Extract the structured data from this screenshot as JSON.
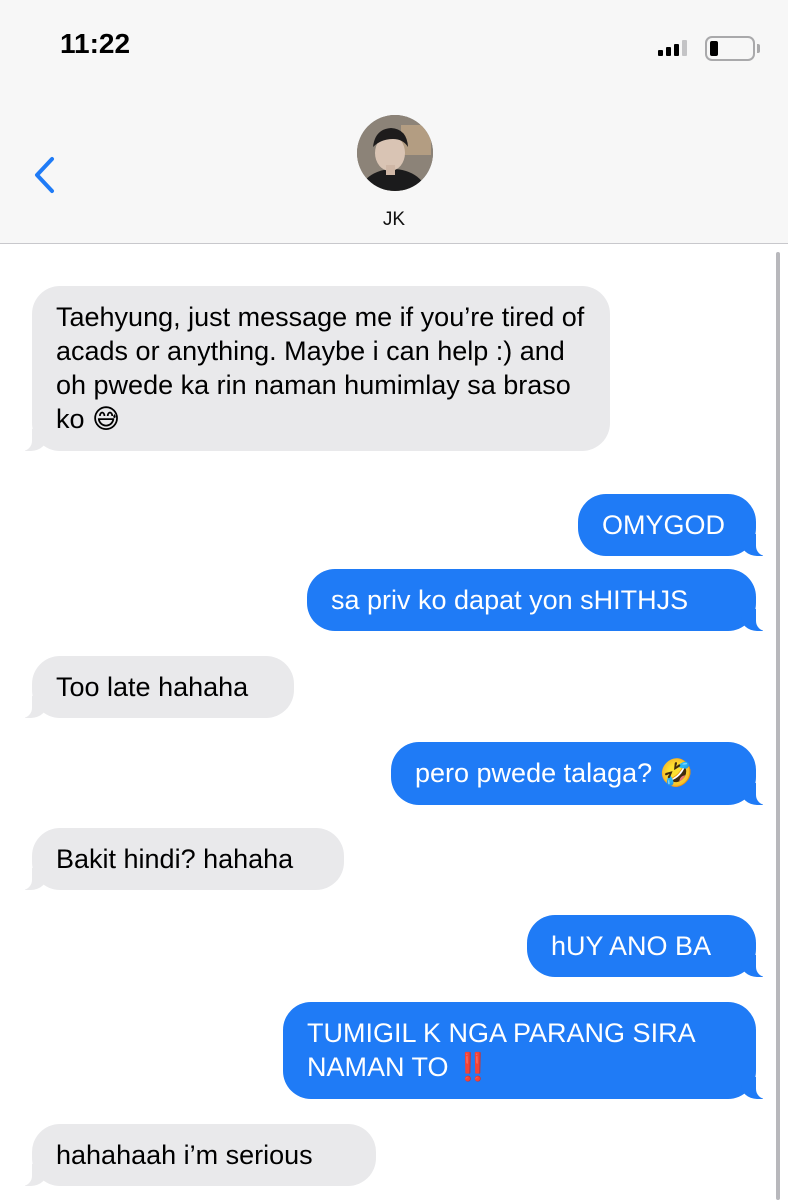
{
  "status_bar": {
    "time": "11:22",
    "signal_bars_lit": 3,
    "signal_bars_total": 4,
    "battery_level_fraction": 0.2
  },
  "header": {
    "contact_name": "JK",
    "back_icon": "chevron-left-icon",
    "accent_color": "#1f7bf6"
  },
  "messages": [
    {
      "direction": "received",
      "text": "Taehyung, just message me if you’re tired of acads or anything. Maybe i can help :) and oh pwede ka rin naman humimlay sa braso ko",
      "emoji": "😅"
    },
    {
      "direction": "sent",
      "text": "OMYGOD"
    },
    {
      "direction": "sent",
      "text": "sa priv ko dapat yon sHITHJS"
    },
    {
      "direction": "received",
      "text": "Too late hahaha"
    },
    {
      "direction": "sent",
      "text": "pero pwede talaga?",
      "emoji": "🤣"
    },
    {
      "direction": "received",
      "text": "Bakit hindi? hahaha"
    },
    {
      "direction": "sent",
      "text": "hUY ANO BA"
    },
    {
      "direction": "sent",
      "text": "TUMIGIL K NGA PARANG SIRA NAMAN TO",
      "emoji": "‼️"
    },
    {
      "direction": "received",
      "text": "hahahaah i’m serious"
    }
  ]
}
